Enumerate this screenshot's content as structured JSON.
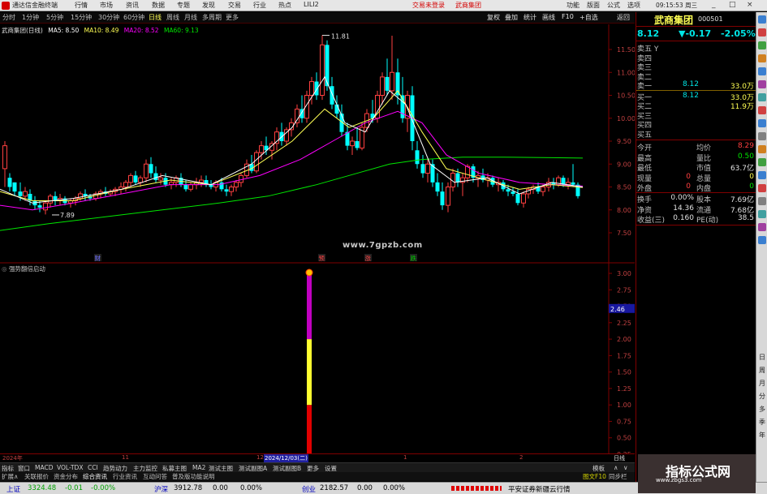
{
  "titlebar": {
    "app_title": "通达信金融终端",
    "menus": [
      "行情",
      "市场",
      "资讯",
      "数据",
      "专题",
      "发现",
      "交易",
      "行业",
      "热点",
      "LILI2"
    ],
    "links": [
      "交易未登录",
      "武商集团"
    ],
    "right_menus": [
      "功能",
      "版面",
      "公式",
      "选项"
    ],
    "clock": "09:15:53 周三",
    "win_buttons": [
      "_",
      "□",
      "×"
    ]
  },
  "toolbar2": {
    "items": [
      "分时",
      "1分钟",
      "5分钟",
      "15分钟",
      "30分钟",
      "60分钟",
      "日线",
      "周线",
      "月线",
      "多周期",
      "更多"
    ],
    "active": "日线",
    "right_items": [
      "复权",
      "叠加",
      "统计",
      "画线",
      "F10",
      "+自选",
      "返回"
    ]
  },
  "chart": {
    "header_name": "武商集团(日线)",
    "ma": [
      {
        "label": "MA5: 8.50",
        "color": "#ffffff"
      },
      {
        "label": "MA10: 8.49",
        "color": "#ffff54"
      },
      {
        "label": "MA20: 8.52",
        "color": "#ff00ff"
      },
      {
        "label": "MA60: 9.13",
        "color": "#00e600"
      }
    ],
    "price_axis": [
      "11.50",
      "11.00",
      "10.50",
      "10.00",
      "9.50",
      "9.00",
      "8.50",
      "8.00",
      "7.50"
    ],
    "high_label": "11.81",
    "low_label": "7.89",
    "watermark": "www.7gpzb.com",
    "event_markers": [
      {
        "text": "财",
        "color": "#7070ff"
      },
      {
        "text": "预",
        "color": "#ff4040"
      },
      {
        "text": "涨",
        "color": "#ff4040"
      },
      {
        "text": "跌",
        "color": "#00c000"
      }
    ]
  },
  "indicator": {
    "name": "强势翻倍启动",
    "axis": [
      "3.00",
      "2.75",
      "2.50",
      "2.25",
      "2.00",
      "1.75",
      "1.50",
      "1.25",
      "1.00",
      "0.75",
      "0.50",
      "0.25"
    ],
    "current_value": "2.46"
  },
  "time_axis": {
    "labels": [
      "2024年",
      "11",
      "12",
      "2024/12/03(二)",
      "1",
      "2"
    ],
    "right_label": "日线"
  },
  "tabs": [
    "指标",
    "窗口",
    "MACD",
    "VOL-TDX",
    "CCI",
    "趋势动力",
    "主力监控",
    "私募主图",
    "MA2",
    "测试主图",
    "测试副图A",
    "测试副图B",
    "更多",
    "设置"
  ],
  "tabs2": [
    "扩展∧",
    "关联报价",
    "资金分布",
    "综合资讯",
    "行业资讯",
    "互动问答",
    "普及版功能说明"
  ],
  "tabs_right": [
    "模板",
    "∧",
    "∨"
  ],
  "rpanel": {
    "stock_name": "武商集团",
    "stock_code": "000501",
    "price": "8.12",
    "change": "▼-0.17",
    "change_pct": "-2.05%",
    "order_book": [
      {
        "label": "卖五",
        "price": "",
        "vol": "",
        "mark": "Y"
      },
      {
        "label": "卖四",
        "price": "",
        "vol": ""
      },
      {
        "label": "卖三",
        "price": "",
        "vol": ""
      },
      {
        "label": "卖二",
        "price": "",
        "vol": ""
      },
      {
        "label": "卖一",
        "price": "8.12",
        "vol": "33.0万"
      },
      {
        "label": "买一",
        "price": "8.12",
        "vol": "33.0万"
      },
      {
        "label": "买二",
        "price": "",
        "vol": "11.9万"
      },
      {
        "label": "买三",
        "price": "",
        "vol": ""
      },
      {
        "label": "买四",
        "price": "",
        "vol": ""
      },
      {
        "label": "买五",
        "price": "",
        "vol": ""
      }
    ],
    "stats": [
      {
        "l1": "今开",
        "v1": "",
        "l2": "均价",
        "v2": "8.29",
        "c2": "#ff4040"
      },
      {
        "l1": "最高",
        "v1": "",
        "l2": "量比",
        "v2": "0.50",
        "c2": "#00e600"
      },
      {
        "l1": "最低",
        "v1": "",
        "l2": "市值",
        "v2": "63.7亿",
        "c2": "#e0e0e0"
      },
      {
        "l1": "现量",
        "v1": "0",
        "l2": "总量",
        "v2": "0",
        "c2": "#ffff54"
      },
      {
        "l1": "外盘",
        "v1": "0",
        "l2": "内盘",
        "v2": "0",
        "c2": "#00e600"
      }
    ],
    "stats2": [
      {
        "l1": "换手",
        "v1": "0.00%",
        "l2": "股本",
        "v2": "7.69亿"
      },
      {
        "l1": "净资",
        "v1": "14.36",
        "l2": "流通",
        "v2": "7.68亿"
      },
      {
        "l1": "收益(三)",
        "v1": "0.160",
        "l2": "PE(动)",
        "v2": "38.5"
      }
    ]
  },
  "vbar": [
    "日",
    "周",
    "月",
    "分",
    "多",
    "季",
    "年"
  ],
  "status": {
    "sh_name": "上证",
    "sh_val": "3324.48",
    "sh_chg": "-0.01",
    "sh_pct": "-0.00%",
    "hs_name": "沪深",
    "hs_val": "3912.78",
    "hs_chg": "0.00",
    "hs_pct": "0.00%",
    "cy_name": "创业",
    "cy_val": "2182.57",
    "cy_chg": "0.00",
    "cy_pct": "0.00%",
    "broker": "平安证券新疆云行情"
  },
  "watermark_brand": "指标公式网",
  "watermark_url": "www.zbgs3.com",
  "bottom_right": [
    "图文F10",
    "同步栏"
  ],
  "colors": {
    "up": "#ff4040",
    "down": "#00ffff",
    "ma5": "#ffffff",
    "ma10": "#ffff54",
    "ma20": "#ff00ff",
    "ma60": "#00e600"
  }
}
